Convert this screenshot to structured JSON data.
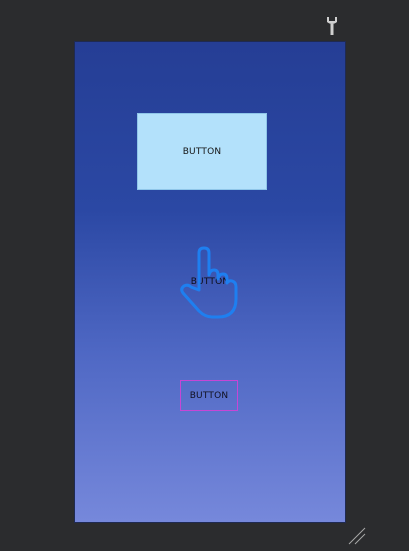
{
  "toolbar": {
    "tool_icon": "wrench-icon"
  },
  "screen": {
    "buttons": [
      {
        "label": "BUTTON",
        "style": "filled-light-blue"
      },
      {
        "label": "BUTTON",
        "style": "text"
      },
      {
        "label": "BUTTON",
        "style": "outlined-magenta"
      }
    ],
    "gesture_icon": "pointing-hand-icon"
  },
  "footer": {
    "resize_icon": "resize-handle-icon"
  },
  "colors": {
    "background": "#2b2c2e",
    "screen_top": "#253e95",
    "screen_bottom": "#7688db",
    "button_fill": "#b3e1fb",
    "outline_magenta": "#c746d6",
    "hand_stroke": "#1e7ff0"
  }
}
